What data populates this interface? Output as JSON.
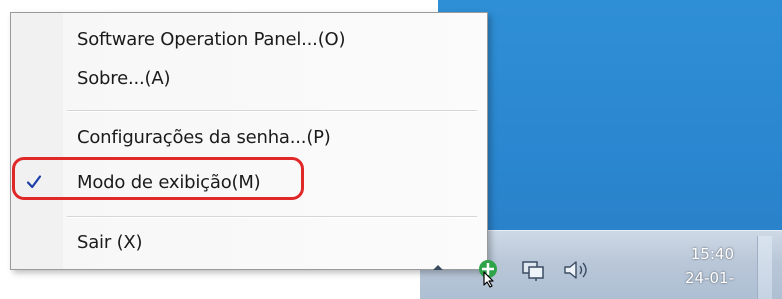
{
  "menu": {
    "items": [
      {
        "label": "Software Operation Panel...(O)",
        "checked": false
      },
      {
        "label": "Sobre...(A)",
        "checked": false
      },
      {
        "label": "Configurações da senha...(P)",
        "checked": false
      },
      {
        "label": "Modo de exibição(M)",
        "checked": true,
        "highlighted": true
      },
      {
        "label": "Sair (X)",
        "checked": false
      }
    ],
    "check_glyph": "✓",
    "highlight_color": "#e02828"
  },
  "tray": {
    "icons": [
      "show-hidden-icons-arrow",
      "scanner-app-icon",
      "network-icon",
      "volume-icon"
    ],
    "time": "15:40",
    "date": "24-01-"
  },
  "colors": {
    "desktop": "#2a86cf",
    "check": "#1c3fa8"
  }
}
